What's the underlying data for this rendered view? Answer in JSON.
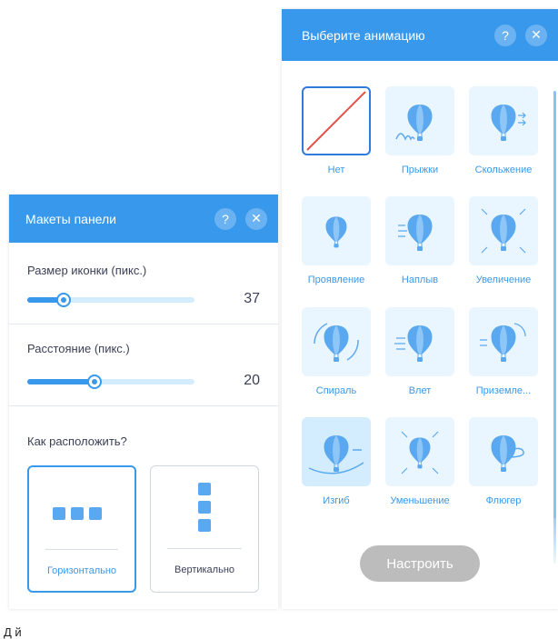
{
  "layout_panel": {
    "title": "Макеты панели",
    "help_label": "?",
    "close_label": "✕",
    "icon_size": {
      "label": "Размер иконки (пикс.)",
      "value": "37",
      "fill_percent": 22
    },
    "spacing": {
      "label": "Расстояние (пикс.)",
      "value": "20",
      "fill_percent": 40
    },
    "arrangement": {
      "question": "Как расположить?",
      "options": [
        {
          "label": "Горизонтально",
          "selected": true
        },
        {
          "label": "Вертикально",
          "selected": false
        }
      ]
    }
  },
  "animation_panel": {
    "title": "Выберите анимацию",
    "help_label": "?",
    "close_label": "✕",
    "items": [
      {
        "label": "Нет",
        "icon": "none-icon",
        "state": "selected"
      },
      {
        "label": "Прыжки",
        "icon": "bounce-balloon-icon"
      },
      {
        "label": "Скольжение",
        "icon": "slide-balloon-icon"
      },
      {
        "label": "Проявление",
        "icon": "fade-balloon-icon"
      },
      {
        "label": "Наплыв",
        "icon": "float-balloon-icon"
      },
      {
        "label": "Увеличение",
        "icon": "expand-balloon-icon"
      },
      {
        "label": "Спираль",
        "icon": "spin-balloon-icon"
      },
      {
        "label": "Влет",
        "icon": "fly-in-balloon-icon"
      },
      {
        "label": "Приземле...",
        "icon": "land-balloon-icon"
      },
      {
        "label": "Изгиб",
        "icon": "bend-balloon-icon",
        "state": "active"
      },
      {
        "label": "Уменьшение",
        "icon": "shrink-balloon-icon"
      },
      {
        "label": "Флюгер",
        "icon": "vane-balloon-icon"
      }
    ],
    "customize_label": "Настроить"
  },
  "footer_text": "Д        й",
  "colors": {
    "accent": "#3899ec",
    "tile_bg": "#eaf6ff",
    "balloon": "#5aa9f0"
  }
}
